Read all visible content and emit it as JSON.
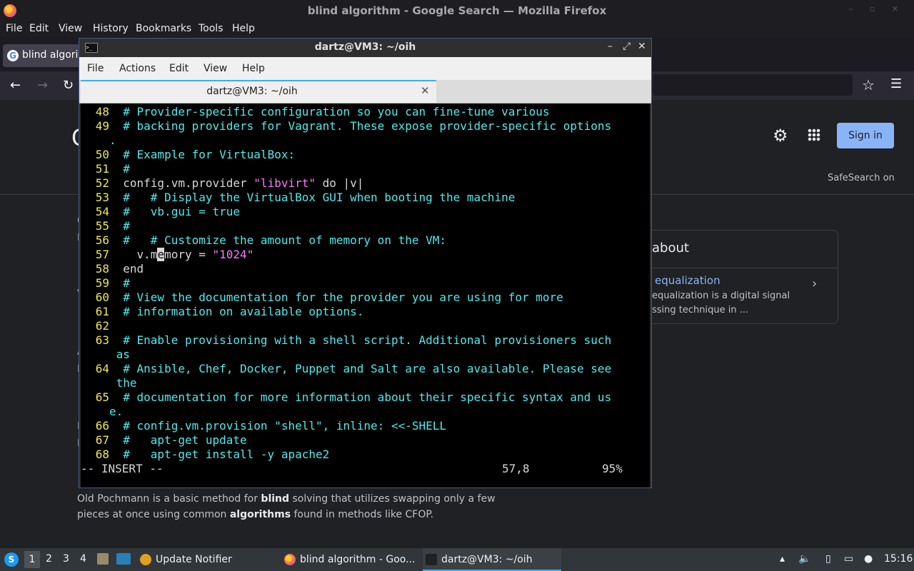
{
  "firefox": {
    "window_title": "blind algorithm - Google Search — Mozilla Firefox",
    "menu": [
      "File",
      "Edit",
      "View",
      "History",
      "Bookmarks",
      "Tools",
      "Help"
    ],
    "tab_label": "blind algorit",
    "tab_favicon": "G"
  },
  "google": {
    "partial_logo": "G",
    "sign_in": "Sign in",
    "safesearch": "SafeSearch on",
    "card": {
      "title": "about",
      "link": "equalization",
      "line1": "equalization is a digital signal",
      "line2": "ssing technique in ..."
    },
    "left_glyphs": [
      "C",
      "M",
      "V",
      "A",
      "B",
      "N",
      "I"
    ],
    "snippet": {
      "part1": "Old Pochmann is a basic method for ",
      "bold1": "blind",
      "part2": " solving that utilizes swapping only a few pieces at once using common ",
      "bold2": "algorithms",
      "part3": " found in methods like CFOP."
    }
  },
  "terminal": {
    "window_title": "dartz@VM3: ~/oih",
    "menu": [
      "File",
      "Actions",
      "Edit",
      "View",
      "Help"
    ],
    "tab_label": "dartz@VM3: ~/oih",
    "lines": [
      {
        "num": "48",
        "text": "  # Provider-specific configuration so you can fine-tune various"
      },
      {
        "num": "49",
        "text": "  # backing providers for Vagrant. These expose provider-specific options"
      },
      {
        "num": "",
        "text": "."
      },
      {
        "num": "50",
        "text": "  # Example for VirtualBox:"
      },
      {
        "num": "51",
        "text": "  #"
      },
      {
        "num": "52",
        "text": "  config.vm.provider ",
        "str": "\"libvirt\"",
        "after": " do |v|",
        "plain": true
      },
      {
        "num": "53",
        "text": "  #   # Display the VirtualBox GUI when booting the machine"
      },
      {
        "num": "54",
        "text": "  #   vb.gui = true"
      },
      {
        "num": "55",
        "text": "  #"
      },
      {
        "num": "56",
        "text": "  #   # Customize the amount of memory on the VM:"
      },
      {
        "num": "57",
        "cursor_line": true,
        "before": "    v.m",
        "cur": "e",
        "rest": "mory = ",
        "str": "\"1024\""
      },
      {
        "num": "58",
        "text": "  end",
        "plain": true
      },
      {
        "num": "59",
        "text": "  #"
      },
      {
        "num": "60",
        "text": "  # View the documentation for the provider you are using for more"
      },
      {
        "num": "61",
        "text": "  # information on available options."
      },
      {
        "num": "62",
        "text": ""
      },
      {
        "num": "63",
        "text": "  # Enable provisioning with a shell script. Additional provisioners such"
      },
      {
        "num": "",
        "text": " as"
      },
      {
        "num": "64",
        "text": "  # Ansible, Chef, Docker, Puppet and Salt are also available. Please see"
      },
      {
        "num": "",
        "text": " the"
      },
      {
        "num": "65",
        "text": "  # documentation for more information about their specific syntax and us"
      },
      {
        "num": "",
        "text": "e."
      },
      {
        "num": "66",
        "text": "  # config.vm.provision \"shell\", inline: <<-SHELL"
      },
      {
        "num": "67",
        "text": "  #   apt-get update"
      },
      {
        "num": "68",
        "text": "  #   apt-get install -y apache2"
      }
    ],
    "status_mode": "-- INSERT --",
    "status_pos": "57,8",
    "status_pct": "95%"
  },
  "taskbar": {
    "workspaces": [
      "1",
      "2",
      "3",
      "4"
    ],
    "tasks": [
      "Update Notifier",
      "blind algorithm - Goo...",
      "dartz@VM3: ~/oih"
    ],
    "clock": "15:16"
  }
}
